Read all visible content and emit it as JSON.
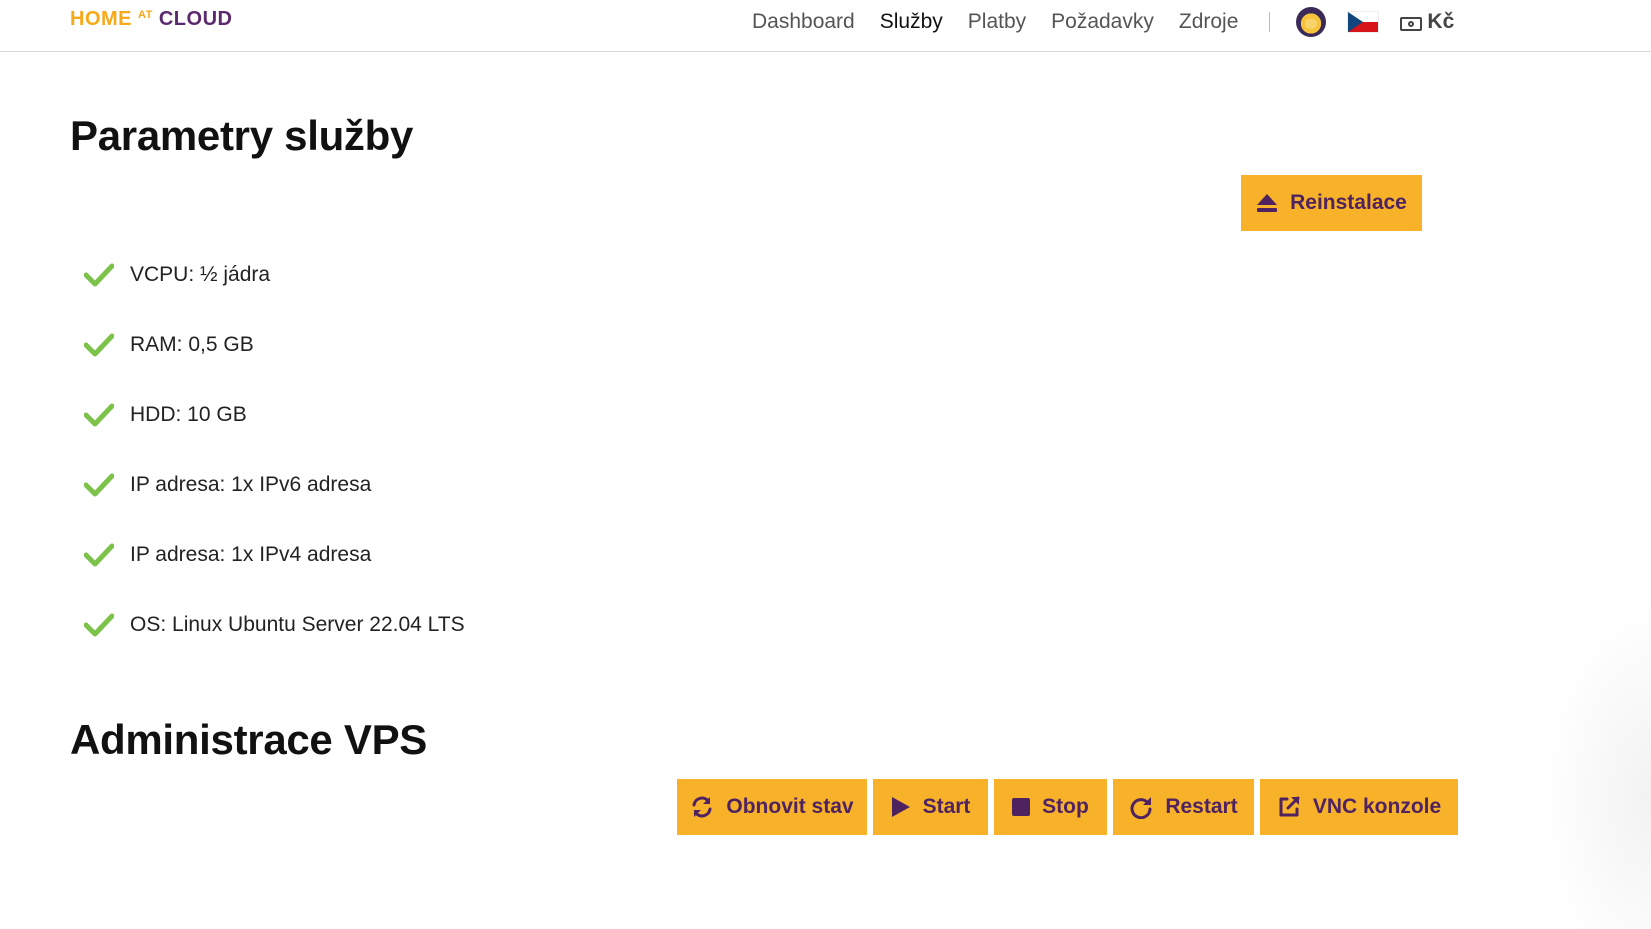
{
  "header": {
    "logo": {
      "home": "HOME",
      "at": "AT",
      "cloud": "CLOUD"
    },
    "nav": [
      {
        "label": "Dashboard",
        "active": false
      },
      {
        "label": "Služby",
        "active": true
      },
      {
        "label": "Platby",
        "active": false
      },
      {
        "label": "Požadavky",
        "active": false
      },
      {
        "label": "Zdroje",
        "active": false
      }
    ],
    "currency": "Kč",
    "language_flag": "cz-flag-icon",
    "avatar": "user-avatar"
  },
  "params": {
    "title": "Parametry služby",
    "reinstall_label": "Reinstalace",
    "items": [
      "VCPU: ½ jádra",
      "RAM: 0,5 GB",
      "HDD: 10 GB",
      "IP adresa: 1x IPv6 adresa",
      "IP adresa: 1x IPv4 adresa",
      "OS: Linux Ubuntu Server 22.04 LTS"
    ]
  },
  "admin": {
    "title": "Administrace VPS",
    "buttons": {
      "refresh": "Obnovit stav",
      "start": "Start",
      "stop": "Stop",
      "restart": "Restart",
      "vnc": "VNC konzole"
    }
  },
  "colors": {
    "accent": "#f8b22a",
    "button_text": "#4f2360",
    "check": "#7dc34a",
    "logo_orange": "#f6a91a",
    "logo_purple": "#5b2a6e"
  }
}
